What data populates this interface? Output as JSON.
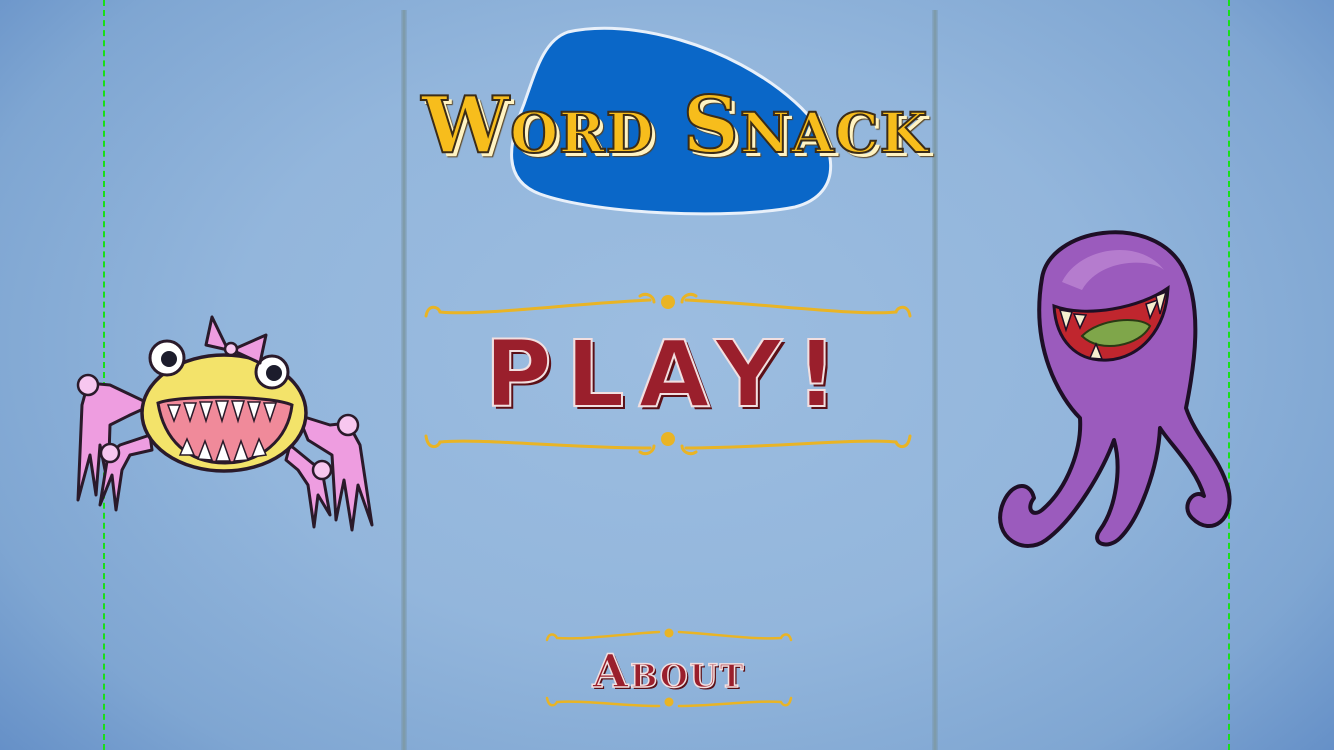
{
  "game": {
    "title": "Word Snack",
    "play_label": "PLAY!",
    "about_label": "About"
  },
  "characters": {
    "left": "spider-monster",
    "right": "octopus-monster"
  },
  "icons": {
    "title_backdrop": "blue-blob",
    "ornament": "scroll-ornament"
  },
  "colors": {
    "background": "#93b6dc",
    "title_fill": "#f7bd1c",
    "title_blob": "#0a67c8",
    "button_text": "#9a1f2c",
    "ornament": "#e9b425",
    "spider_body": "#f3e36a",
    "spider_legs": "#ee9de0",
    "octopus": "#9b5bbd",
    "guide_line": "#18e018"
  }
}
